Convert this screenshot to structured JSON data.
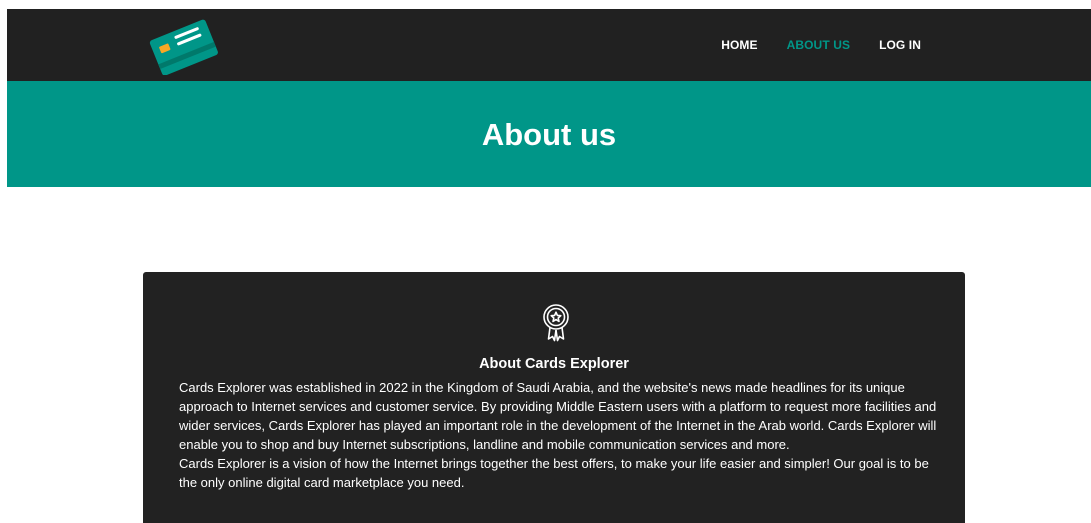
{
  "navbar": {
    "logo_icon": "credit-card-icon",
    "links": [
      {
        "label": "HOME",
        "active": false
      },
      {
        "label": "ABOUT US",
        "active": true
      },
      {
        "label": "LOG IN",
        "active": false
      }
    ]
  },
  "hero": {
    "title": "About us"
  },
  "about": {
    "icon": "award-ribbon-icon",
    "title": "About Cards Explorer",
    "paragraph_1": "Cards Explorer was established in 2022 in the Kingdom of Saudi Arabia, and the website's news made headlines for its unique approach to Internet services and customer service. By providing Middle Eastern users with a platform to request more facilities and wider services, Cards Explorer has played an important role in the development of the Internet in the Arab world. Cards Explorer will enable you to shop and buy Internet subscriptions, landline and mobile communication services and more.",
    "paragraph_2": "Cards Explorer is a vision of how the Internet brings together the best offers, to make your life easier and simpler! Our goal is to be the only online digital card marketplace you need."
  },
  "colors": {
    "navbar_bg": "#212121",
    "accent": "#009688",
    "card_bg": "#222222",
    "text": "#ffffff"
  }
}
